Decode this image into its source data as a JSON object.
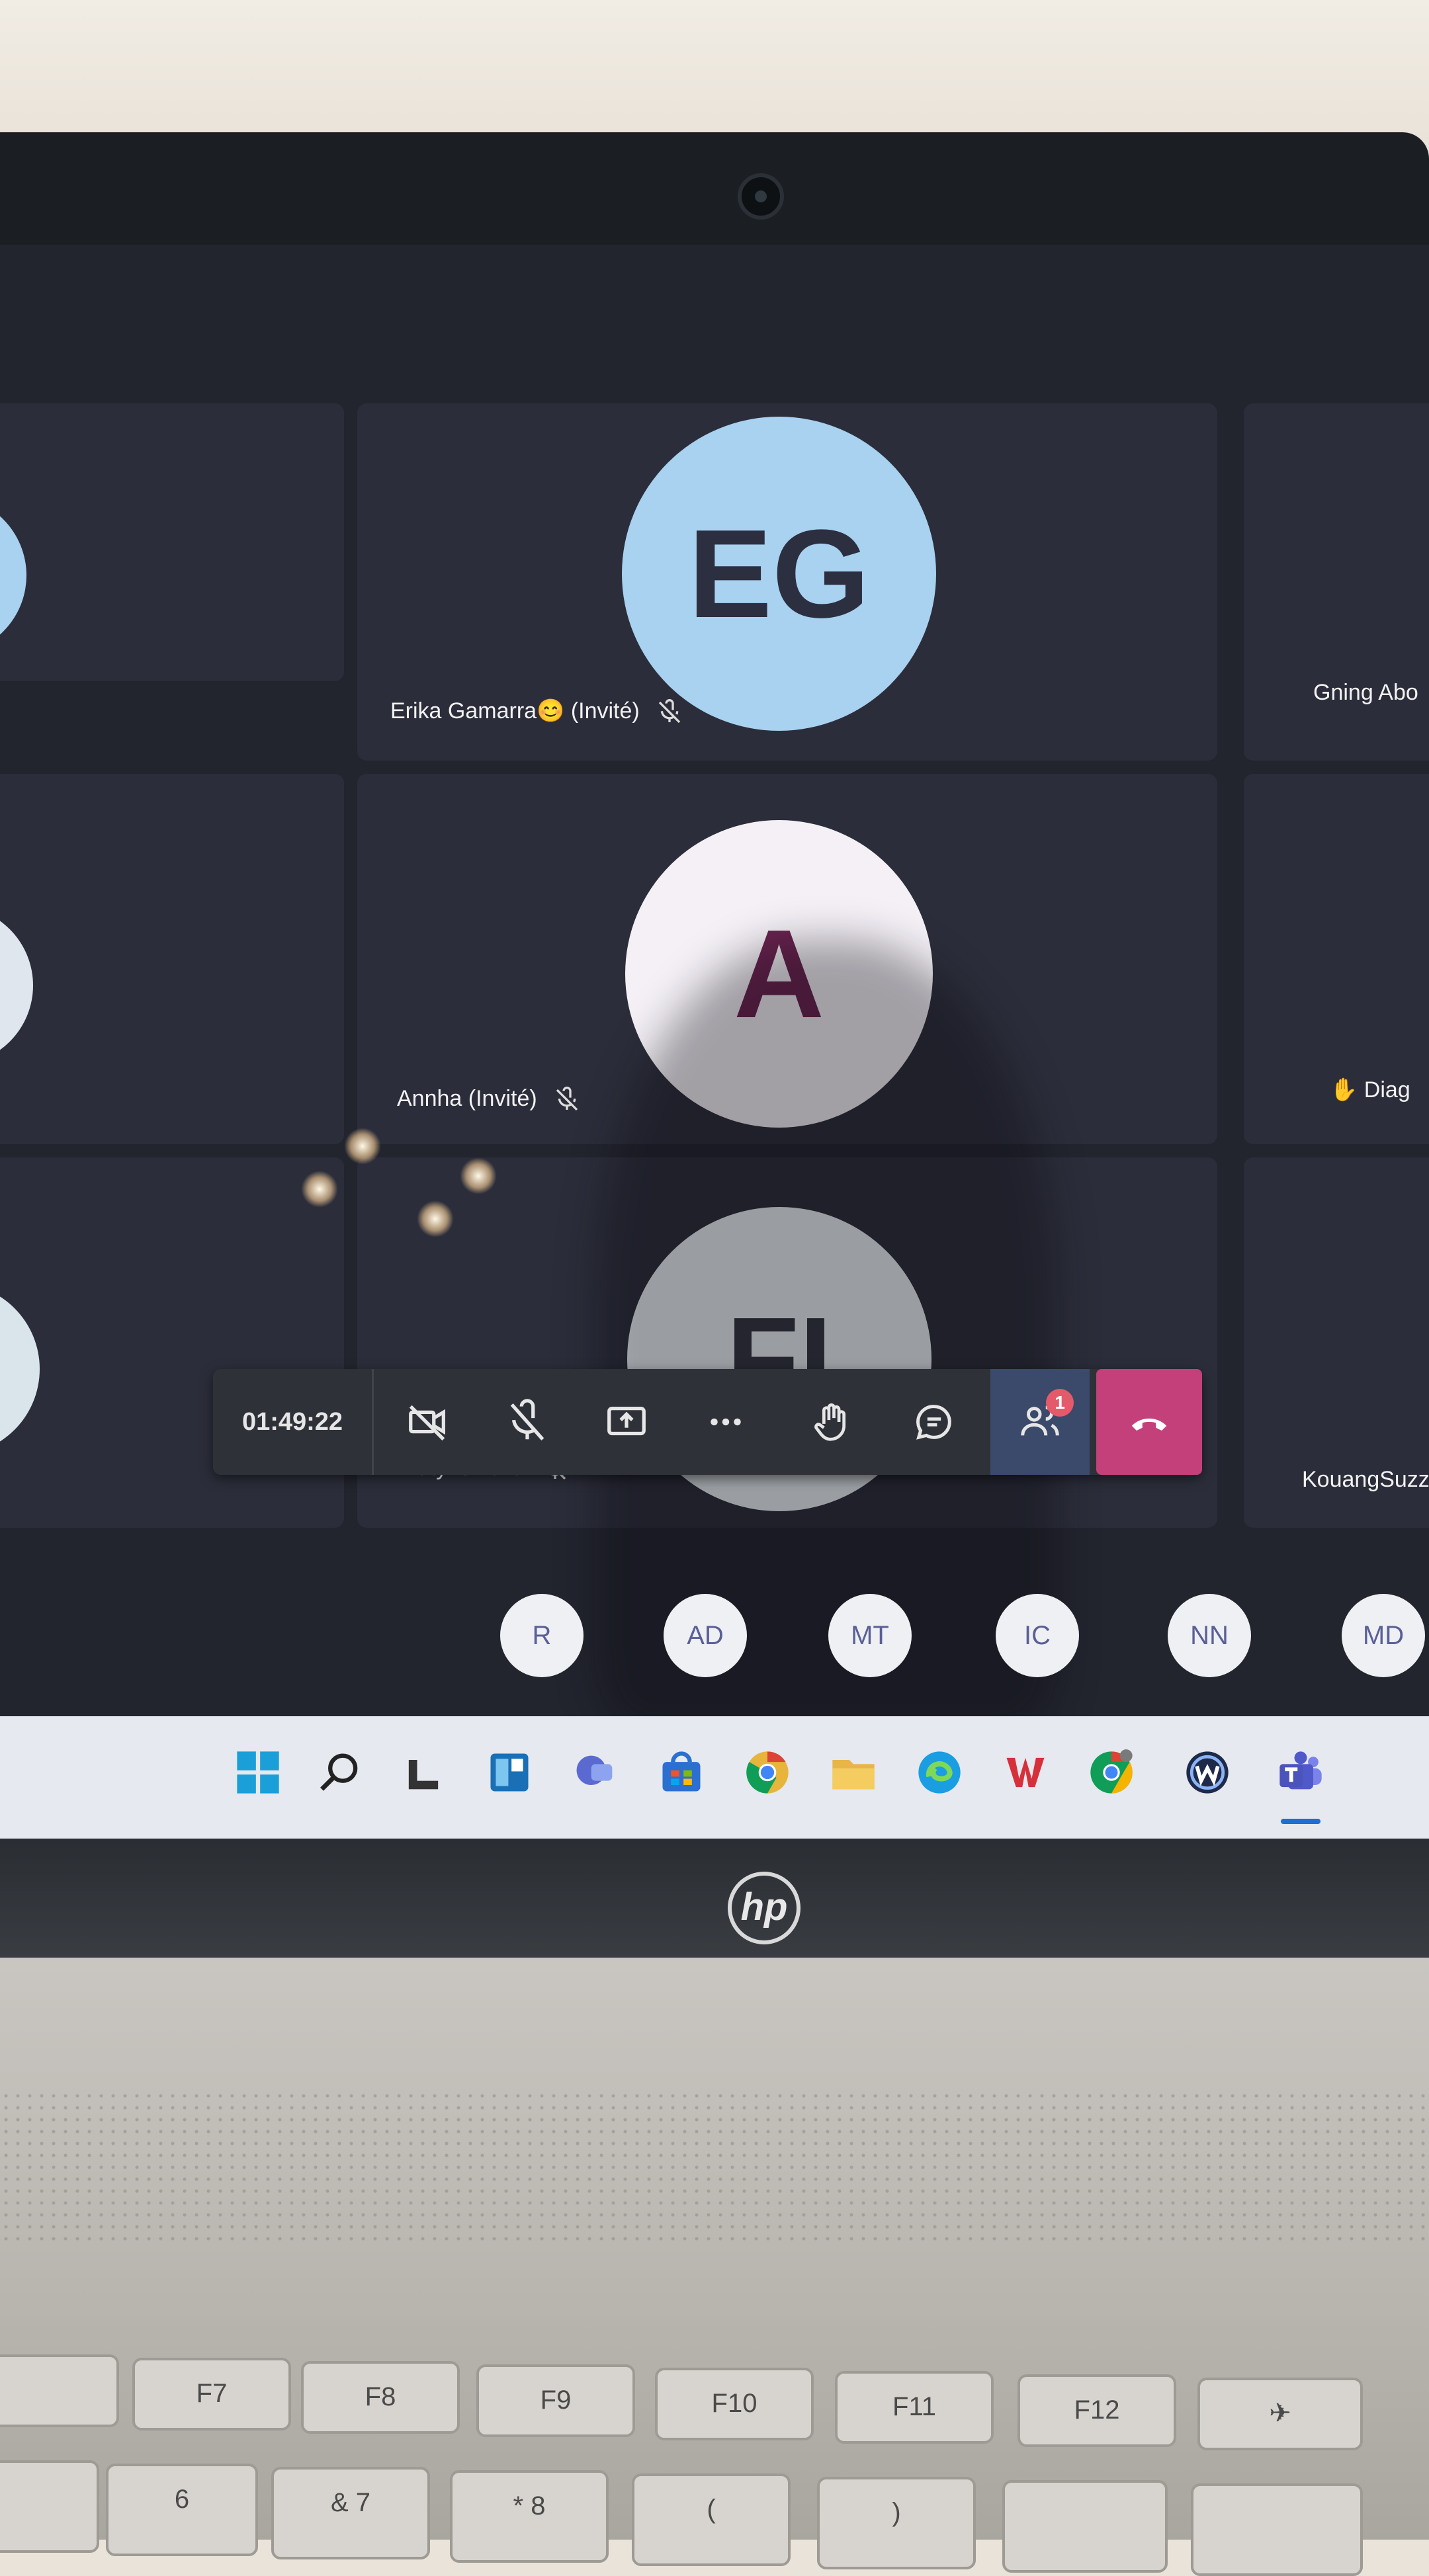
{
  "meeting": {
    "participants": [
      {
        "initials": "EG",
        "name": "Erika Gamarra😊 (Invité)",
        "bg": "#a9d1f0",
        "fg": "#2c2f40"
      },
      {
        "initials": "A",
        "name": "Annha (Invité)",
        "bg": "#f4f0f6",
        "fg": "#6b2350"
      },
      {
        "initials": "FI",
        "name": "Faty Ismaila",
        "bg": "#e9eef2",
        "fg": "#33353f"
      }
    ],
    "side_labels": {
      "right_top": "Gning Abo",
      "right_mid": "Diag",
      "right_bottom": "KouangSuzz"
    }
  },
  "controls": {
    "timer": "01:49:22",
    "participants_badge": "1",
    "buttons": [
      {
        "name": "camera-off",
        "icon": "video-off-icon"
      },
      {
        "name": "mic-off",
        "icon": "mic-off-icon"
      },
      {
        "name": "share",
        "icon": "share-screen-icon"
      },
      {
        "name": "more",
        "icon": "more-icon"
      },
      {
        "name": "raise-hand",
        "icon": "hand-icon"
      },
      {
        "name": "chat",
        "icon": "chat-icon"
      },
      {
        "name": "participants",
        "icon": "people-icon"
      },
      {
        "name": "hang-up",
        "icon": "phone-hangup-icon"
      }
    ],
    "hangup_color": "#c4407a"
  },
  "participant_strip": [
    "R",
    "AD",
    "MT",
    "IC",
    "NN",
    "MD"
  ],
  "taskbar": {
    "apps": [
      "start-icon",
      "search-icon",
      "widgets-icon",
      "task-view-icon",
      "chat-icon",
      "store-icon",
      "chrome-icon",
      "file-explorer-icon",
      "edge-icon",
      "wps-icon",
      "chrome-profile-icon",
      "app-icon",
      "teams-icon"
    ]
  },
  "device": {
    "logo": "hp"
  },
  "keyboard": {
    "top_row": [
      "F7",
      "F8",
      "F9",
      "F10",
      "F11",
      "F12"
    ],
    "number_row": [
      "6",
      "&",
      "7",
      "*",
      "8",
      "(",
      ")"
    ]
  }
}
